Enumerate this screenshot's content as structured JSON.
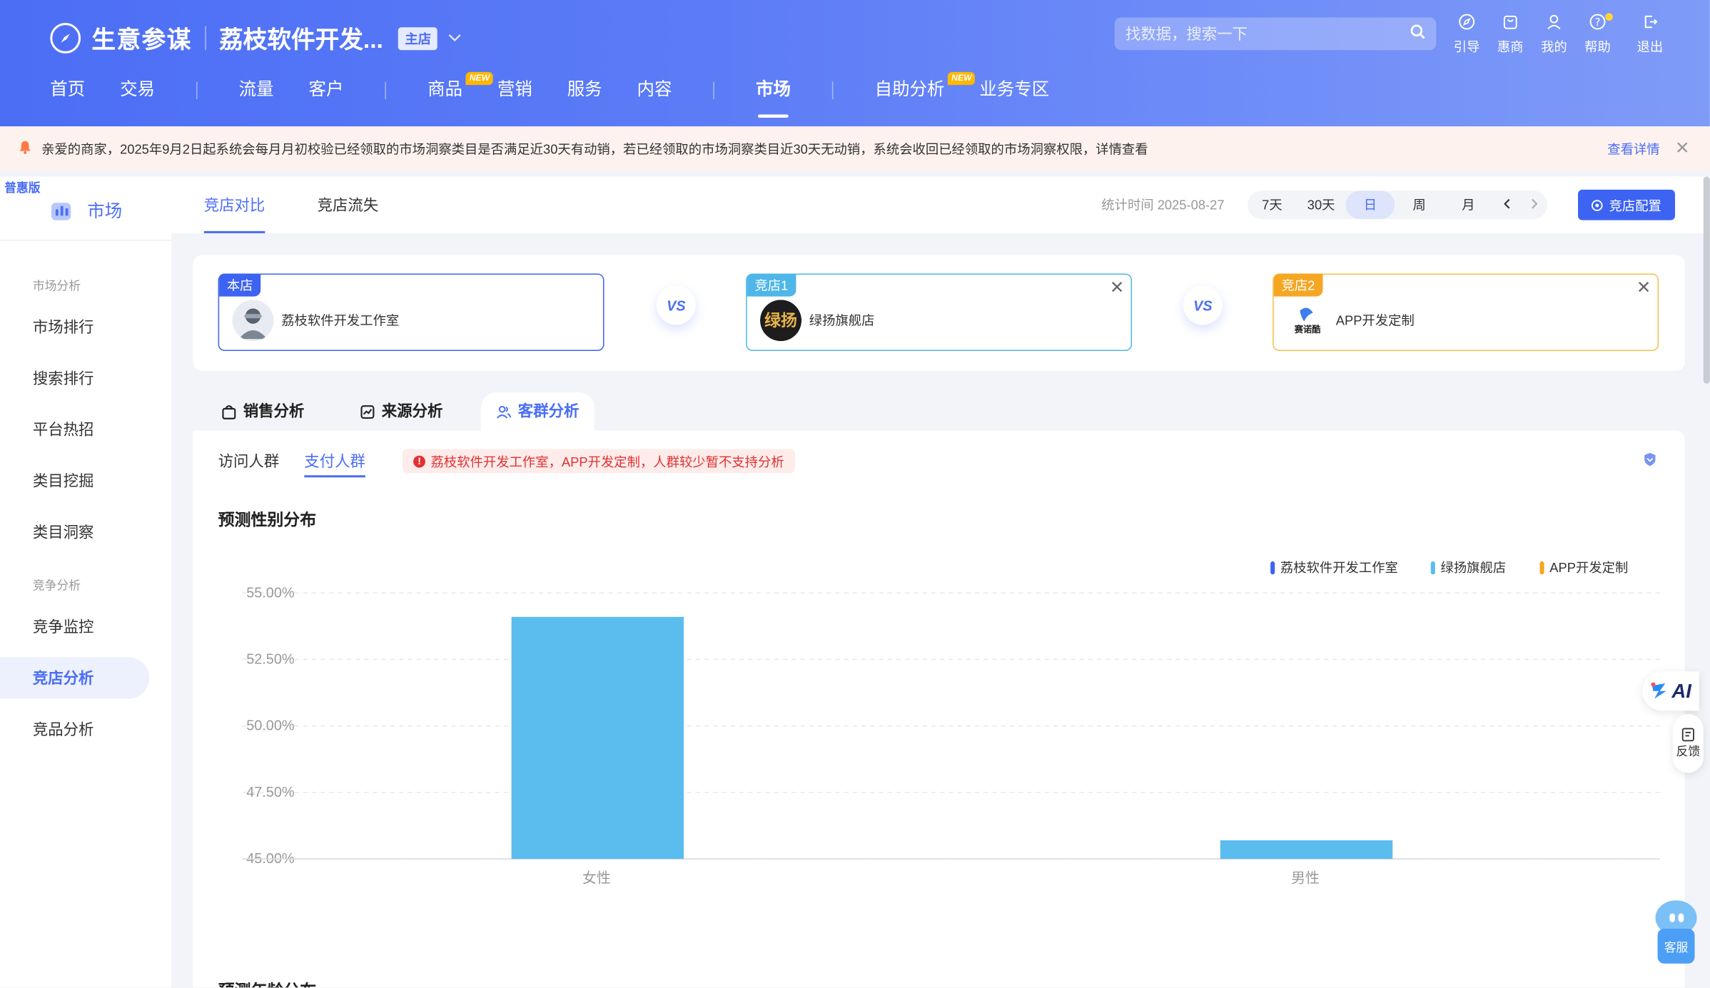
{
  "header": {
    "app_name": "生意参谋",
    "shop_name": "荔枝软件开发...",
    "shop_badge": "主店",
    "search_placeholder": "找数据，搜索一下",
    "tools": [
      {
        "label": "引导",
        "icon": "compass-icon"
      },
      {
        "label": "惠商",
        "icon": "bag-icon"
      },
      {
        "label": "我的",
        "icon": "user-icon"
      },
      {
        "label": "帮助",
        "icon": "help-icon"
      },
      {
        "label": "退出",
        "icon": "logout-icon"
      }
    ],
    "nav": [
      {
        "label": "首页"
      },
      {
        "label": "交易"
      },
      {
        "label": "流量"
      },
      {
        "label": "客户"
      },
      {
        "label": "商品",
        "tag": "NEW"
      },
      {
        "label": "营销"
      },
      {
        "label": "服务"
      },
      {
        "label": "内容"
      },
      {
        "label": "市场"
      },
      {
        "label": "自助分析",
        "tag": "NEW"
      },
      {
        "label": "业务专区"
      }
    ]
  },
  "notice": {
    "text": "亲爱的商家，2025年9月2日起系统会每月月初校验已经领取的市场洞察类目是否满足近30天有动销，若已经领取的市场洞察类目近30天无动销，系统会收回已经领取的市场洞察权限，详情查看",
    "link": "查看详情"
  },
  "sidebar": {
    "edition": "普惠版",
    "title": "市场",
    "groups": [
      {
        "label": "市场分析",
        "items": [
          "市场排行",
          "搜索排行",
          "平台热招",
          "类目挖掘",
          "类目洞察"
        ]
      },
      {
        "label": "竞争分析",
        "items": [
          "竞争监控",
          "竞店分析",
          "竞品分析"
        ]
      }
    ],
    "active": "竞店分析"
  },
  "main": {
    "tabs": [
      "竞店对比",
      "竞店流失"
    ],
    "stat_time": "统计时间 2025-08-27",
    "periods": [
      "7天",
      "30天",
      "日",
      "周",
      "月"
    ],
    "active_period": "日",
    "config_button": "竞店配置",
    "shops": [
      {
        "tag": "本店",
        "name": "荔枝软件开发工作室",
        "color": "#3d63f2"
      },
      {
        "tag": "竞店1",
        "name": "绿扬旗舰店",
        "color": "#4fb6e8"
      },
      {
        "tag": "竞店2",
        "name": "APP开发定制",
        "color": "#f5a623"
      }
    ],
    "vs": "VS",
    "analysis_tabs": [
      "销售分析",
      "来源分析",
      "客群分析"
    ],
    "active_analysis": "客群分析",
    "sub_tabs": [
      "访问人群",
      "支付人群"
    ],
    "active_sub_tab": "支付人群",
    "warning": "荔枝软件开发工作室，APP开发定制，人群较少暂不支持分析",
    "section1_title": "预测性别分布",
    "section2_title": "预测年龄分布"
  },
  "floating": {
    "ai": "AI",
    "feedback": "反馈",
    "service": "客服"
  },
  "chart_data": {
    "type": "bar",
    "title": "预测性别分布",
    "categories": [
      "女性",
      "男性"
    ],
    "series": [
      {
        "name": "荔枝软件开发工作室",
        "color": "#3d63f2",
        "values": [
          null,
          null
        ]
      },
      {
        "name": "绿扬旗舰店",
        "color": "#5bbcee",
        "values": [
          54.1,
          45.7
        ]
      },
      {
        "name": "APP开发定制",
        "color": "#f5a623",
        "values": [
          null,
          null
        ]
      }
    ],
    "yticks": [
      "55.00%",
      "52.50%",
      "50.00%",
      "47.50%",
      "45.00%"
    ],
    "ylim": [
      45,
      55
    ],
    "grid": true,
    "legend": "top-right"
  }
}
